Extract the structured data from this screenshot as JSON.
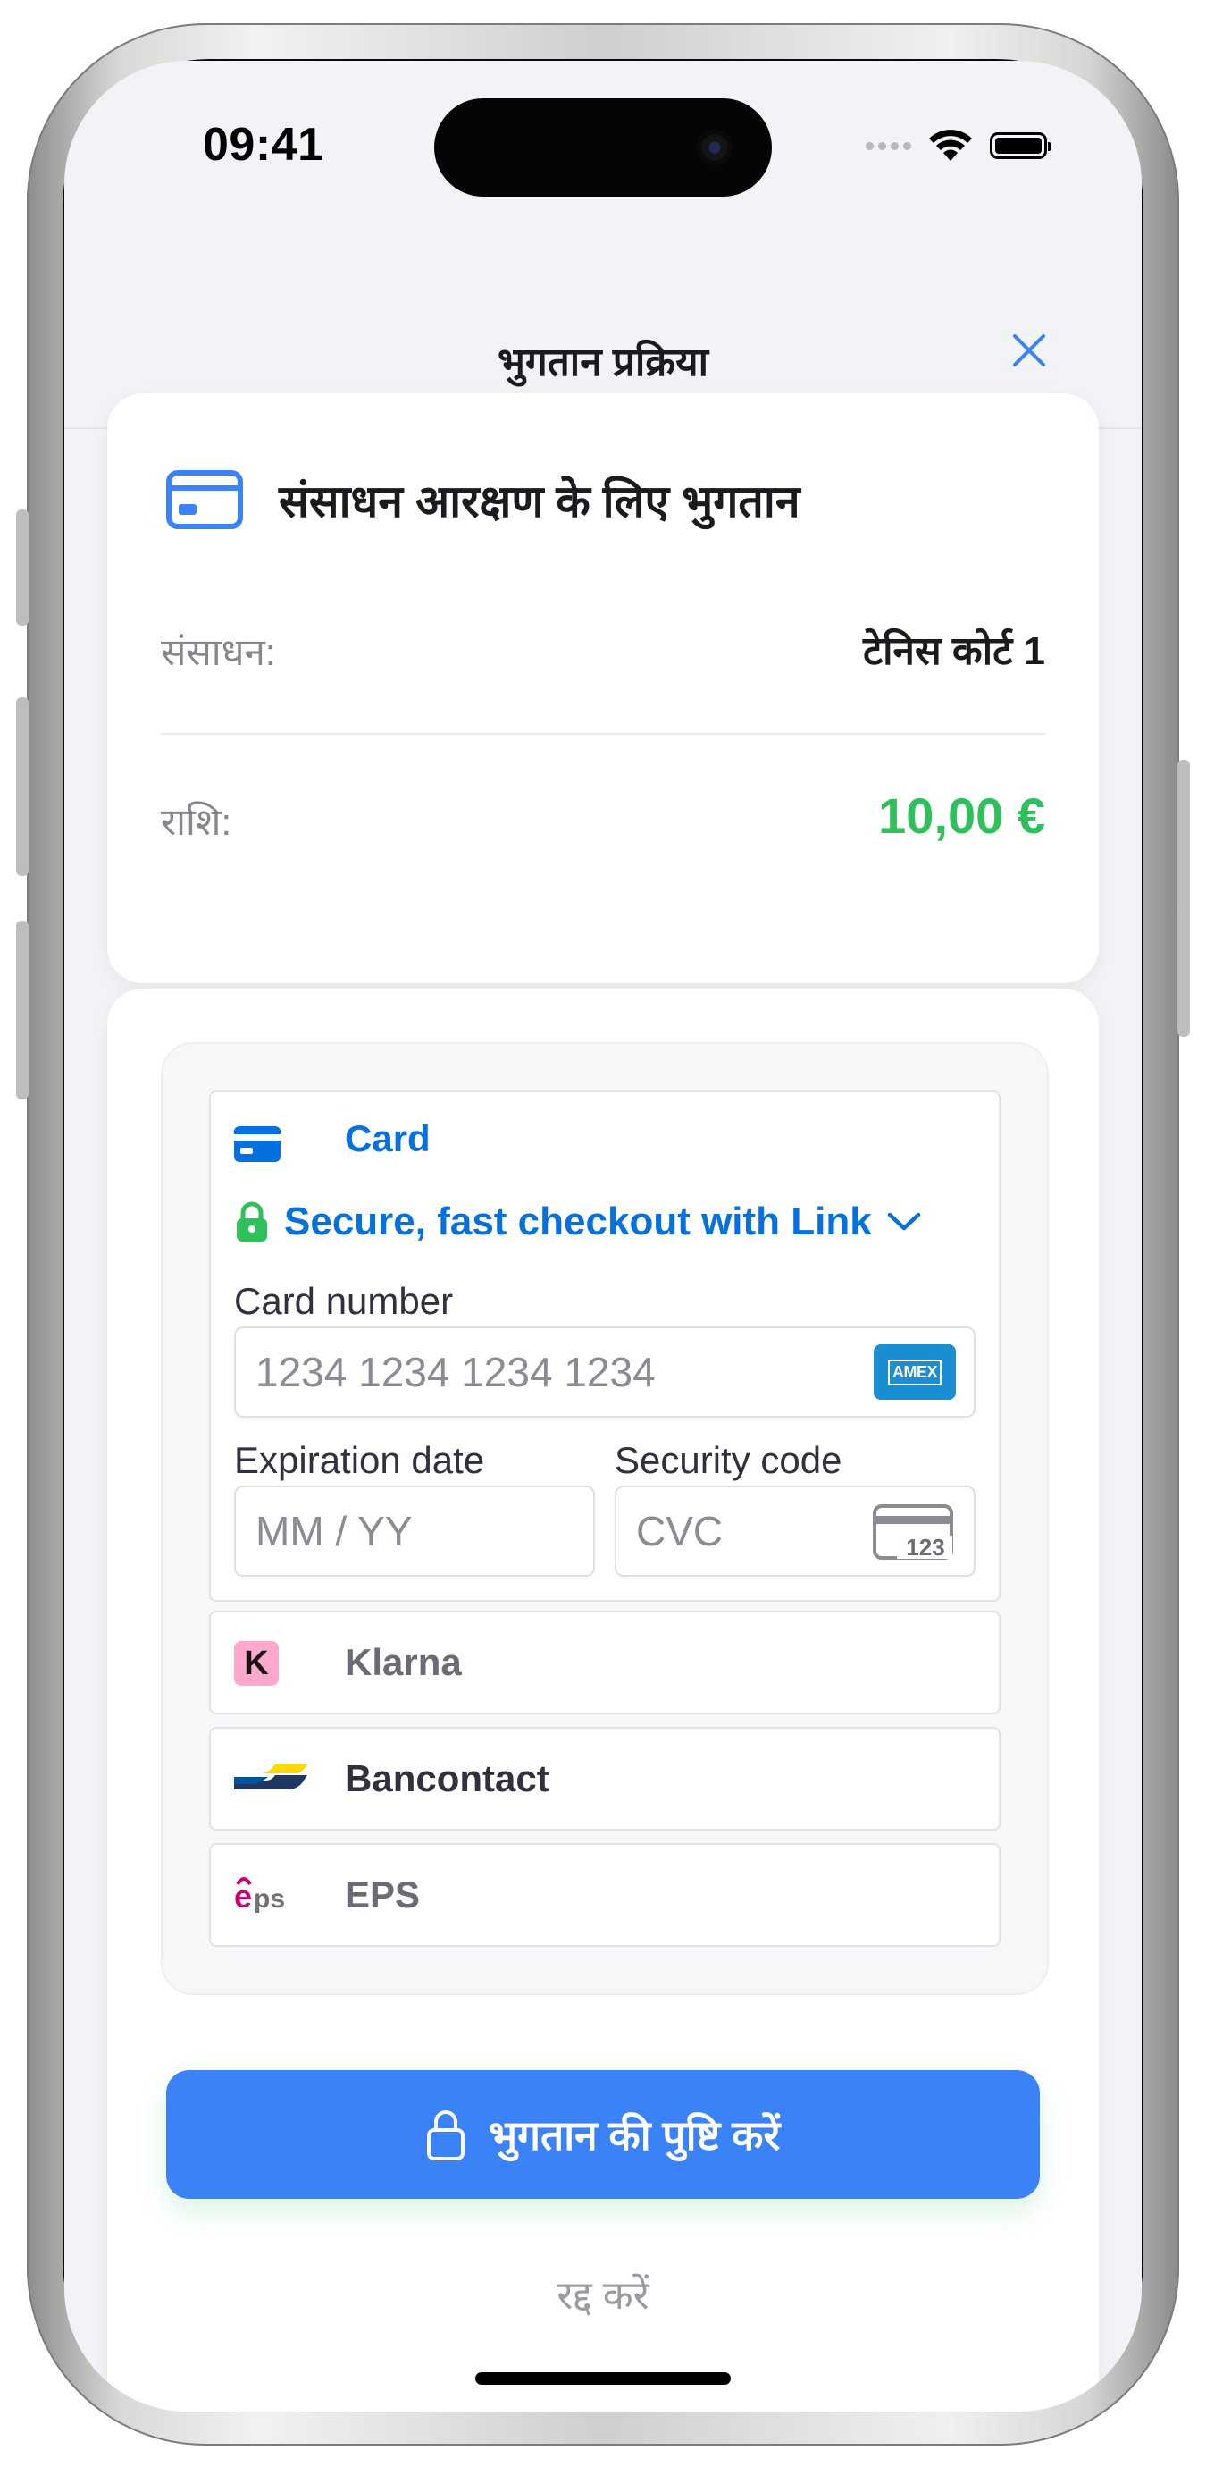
{
  "status_bar": {
    "time": "09:41"
  },
  "header": {
    "title": "भुगतान प्रक्रिया",
    "close_icon": "close-icon"
  },
  "summary": {
    "title": "संसाधन आरक्षण के लिए भुगतान",
    "resource_label": "संसाधन:",
    "resource_value": "टेनिस कोर्ट 1",
    "amount_label": "राशि:",
    "amount_value": "10,00 €",
    "accent_color": "#3b82f6",
    "amount_color": "#2fbf5b"
  },
  "payment": {
    "card_tab_label": "Card",
    "link_text": "Secure, fast checkout with Link",
    "card_number_label": "Card number",
    "card_number_placeholder": "1234 1234 1234 1234",
    "card_brand": "AMEX",
    "expiry_label": "Expiration date",
    "expiry_placeholder": "MM / YY",
    "security_label": "Security code",
    "security_placeholder": "CVC",
    "cvc_icon_text": "123",
    "methods": [
      {
        "label": "Klarna",
        "logo": "K"
      },
      {
        "label": "Bancontact"
      },
      {
        "label": "EPS"
      }
    ]
  },
  "actions": {
    "confirm_label": "भुगतान की पुष्टि करें",
    "cancel_label": "रद्द करें"
  }
}
